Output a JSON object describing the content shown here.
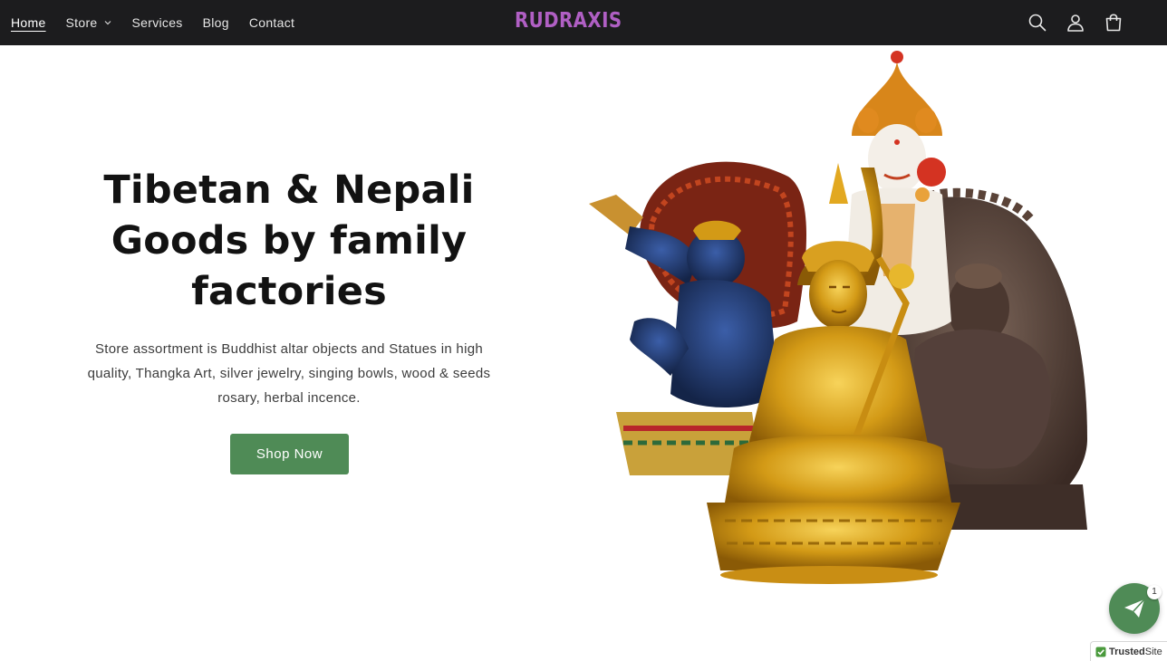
{
  "nav": {
    "items": [
      {
        "label": "Home",
        "active": true
      },
      {
        "label": "Store",
        "has_dropdown": true
      },
      {
        "label": "Services"
      },
      {
        "label": "Blog"
      },
      {
        "label": "Contact"
      }
    ]
  },
  "brand": {
    "logo_text": "RUDRAXIS",
    "logo_color": "#b05fc4"
  },
  "header_icons": [
    "search-icon",
    "account-icon",
    "cart-icon"
  ],
  "hero": {
    "title_lines": [
      "Tibetan & Nepali",
      "Goods by family",
      "factories"
    ],
    "description_lines": [
      "Store assortment is Buddhist altar objects and Statues in high",
      "quality, Thangka Art, silver jewelry, singing bowls, wood & seeds",
      "rosary, herbal incence."
    ],
    "cta_label": "Shop Now",
    "cta_color": "#4f8b56",
    "image": "buddhist-statues-image"
  },
  "chat_widget": {
    "icon": "paper-plane-icon",
    "badge_count": "1"
  },
  "trusted_badge": {
    "strong": "Trusted",
    "rest": "Site"
  },
  "colors": {
    "header_bg": "#1c1c1e",
    "accent_green": "#4f8b56"
  }
}
